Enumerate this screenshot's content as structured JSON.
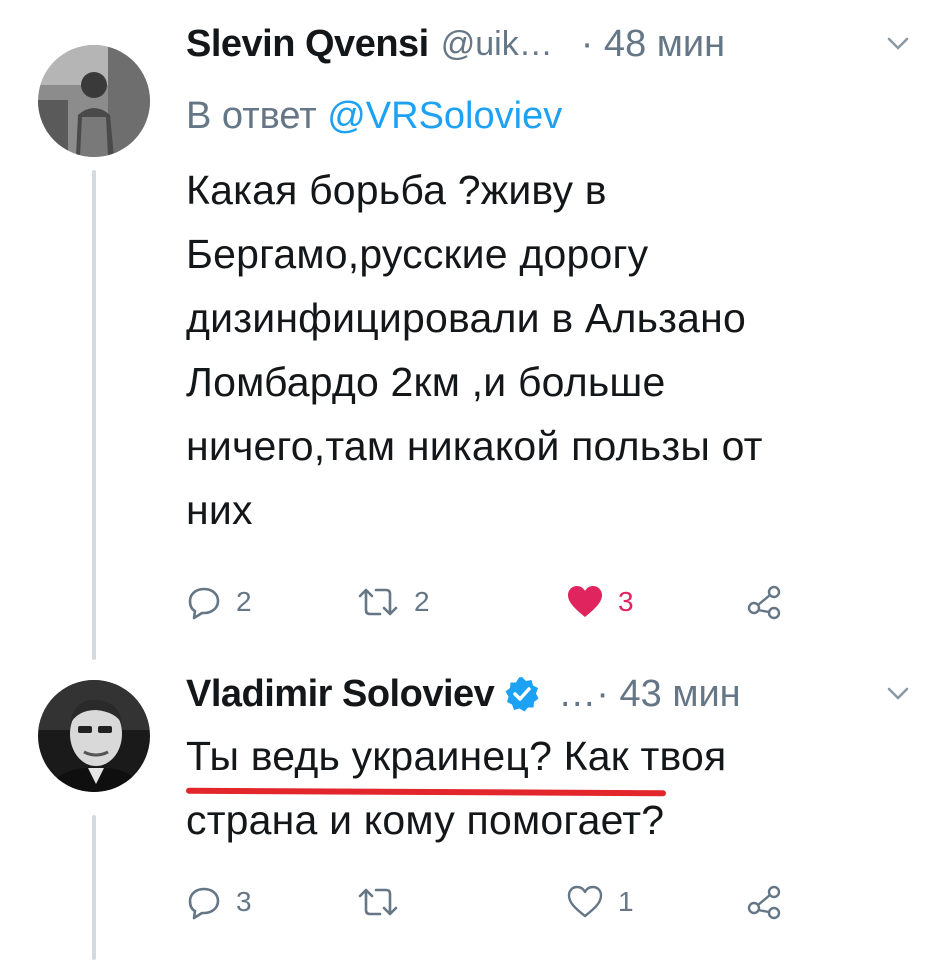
{
  "tweets": [
    {
      "author": {
        "name": "Slevin Qvensi",
        "handle": "@uik…",
        "avatar_icon": "user-avatar-photo"
      },
      "time": "· 48 мин",
      "reply_to": {
        "prefix": "В ответ ",
        "mention": "@VRSoloviev"
      },
      "text": "Какая борьба ?живу в\nБергамо,русские дорогу\nдизинфицировали в Альзано\nЛомбардо 2км ,и больше\nничего,там никакой пользы от\nних",
      "actions": {
        "replies": "2",
        "retweets": "2",
        "likes": "3",
        "liked": true
      }
    },
    {
      "author": {
        "name": "Vladimir Soloviev",
        "handle": "",
        "verified": true,
        "avatar_icon": "user-avatar-photo"
      },
      "time": "…· 43 мин",
      "text": "Ты ведь украинец? Как твоя\nстрана и кому помогает?",
      "actions": {
        "replies": "3",
        "retweets": "",
        "likes": "1",
        "liked": false
      }
    }
  ],
  "colors": {
    "text": "#14171a",
    "secondary": "#657786",
    "link": "#1da1f2",
    "like": "#e0245e",
    "verified": "#1da1f2",
    "annotation_underline": "#e2262b",
    "thread_line": "#d4dbe0"
  }
}
